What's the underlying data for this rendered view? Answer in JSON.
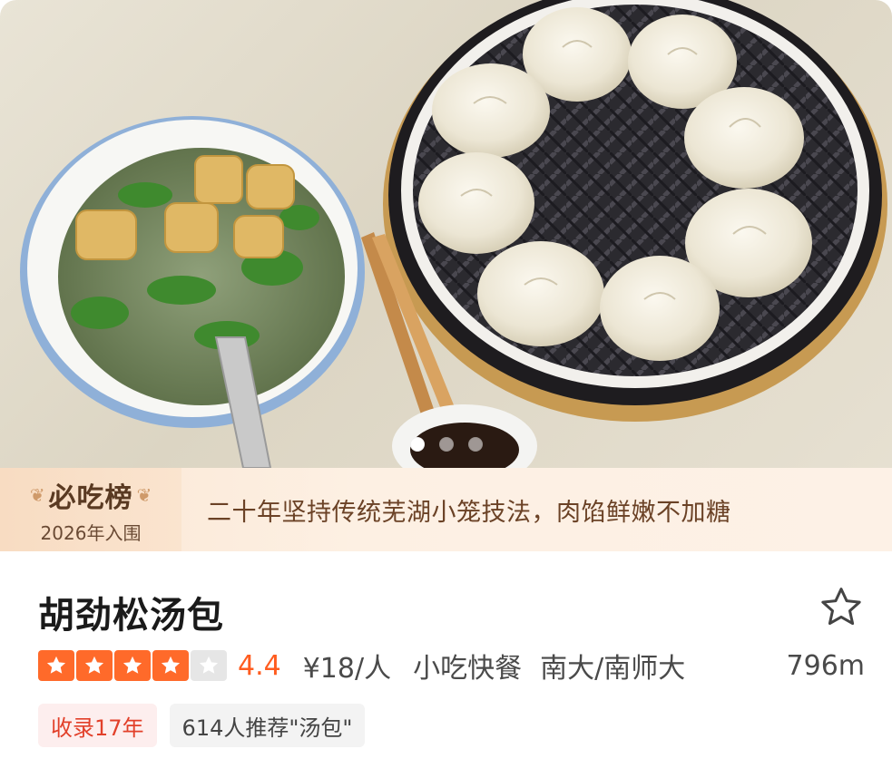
{
  "carousel": {
    "dot_count": 3,
    "active_index": 0
  },
  "banner": {
    "badge_title": "必吃榜",
    "badge_subtitle": "2026年入围",
    "tagline": "二十年坚持传统芜湖小笼技法，肉馅鲜嫩不加糖"
  },
  "restaurant": {
    "name": "胡劲松汤包",
    "rating": 4.4,
    "rating_text": "4.4",
    "stars_filled": 4,
    "stars_total": 5,
    "price": "¥18/人",
    "category": "小吃快餐",
    "area": "南大/南师大",
    "distance": "796m"
  },
  "tags": [
    {
      "text": "收录17年",
      "style": "red"
    },
    {
      "text": "614人推荐\"汤包\"",
      "style": "grey"
    }
  ],
  "icons": {
    "favorite": "star-outline-icon",
    "rating_star": "star-icon",
    "laurel": "laurel-icon"
  },
  "colors": {
    "accent": "#ff6a2a",
    "score": "#ff5c1f",
    "banner_bg": "#fdf0e3",
    "tag_red_text": "#e2402a"
  }
}
